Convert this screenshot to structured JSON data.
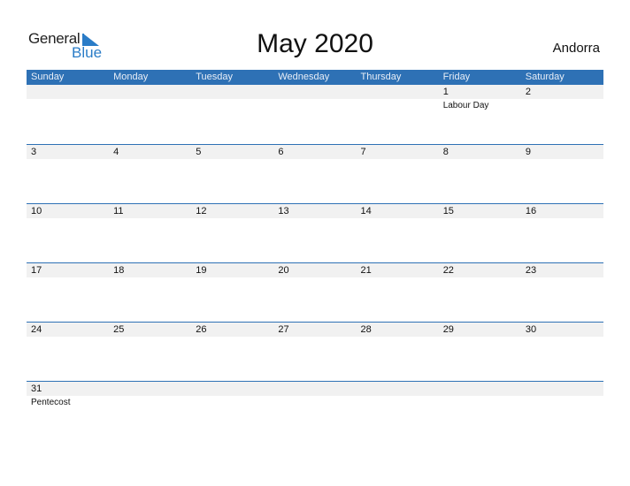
{
  "logo": {
    "line1": "General",
    "line2": "Blue",
    "accent": "#2a7cc7"
  },
  "title": "May 2020",
  "country": "Andorra",
  "colors": {
    "header_bg": "#2e71b5",
    "band_bg": "#f1f1f1"
  },
  "weekdays": [
    "Sunday",
    "Monday",
    "Tuesday",
    "Wednesday",
    "Thursday",
    "Friday",
    "Saturday"
  ],
  "weeks": [
    [
      {
        "day": ""
      },
      {
        "day": ""
      },
      {
        "day": ""
      },
      {
        "day": ""
      },
      {
        "day": ""
      },
      {
        "day": "1",
        "event": "Labour Day"
      },
      {
        "day": "2"
      }
    ],
    [
      {
        "day": "3"
      },
      {
        "day": "4"
      },
      {
        "day": "5"
      },
      {
        "day": "6"
      },
      {
        "day": "7"
      },
      {
        "day": "8"
      },
      {
        "day": "9"
      }
    ],
    [
      {
        "day": "10"
      },
      {
        "day": "11"
      },
      {
        "day": "12"
      },
      {
        "day": "13"
      },
      {
        "day": "14"
      },
      {
        "day": "15"
      },
      {
        "day": "16"
      }
    ],
    [
      {
        "day": "17"
      },
      {
        "day": "18"
      },
      {
        "day": "19"
      },
      {
        "day": "20"
      },
      {
        "day": "21"
      },
      {
        "day": "22"
      },
      {
        "day": "23"
      }
    ],
    [
      {
        "day": "24"
      },
      {
        "day": "25"
      },
      {
        "day": "26"
      },
      {
        "day": "27"
      },
      {
        "day": "28"
      },
      {
        "day": "29"
      },
      {
        "day": "30"
      }
    ],
    [
      {
        "day": "31",
        "event": "Pentecost"
      },
      {
        "day": ""
      },
      {
        "day": ""
      },
      {
        "day": ""
      },
      {
        "day": ""
      },
      {
        "day": ""
      },
      {
        "day": ""
      }
    ]
  ]
}
